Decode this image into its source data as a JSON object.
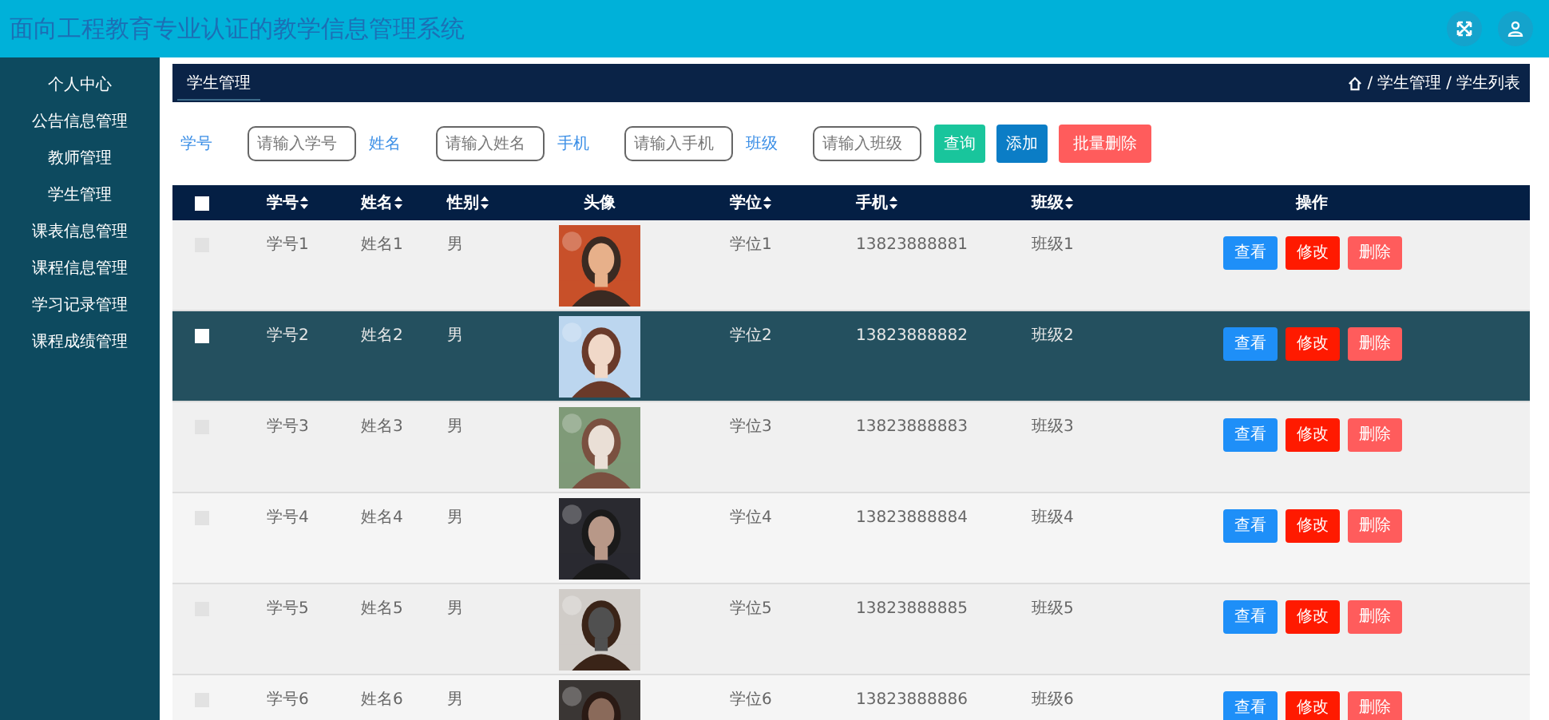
{
  "header": {
    "title": "面向工程教育专业认证的教学信息管理系统"
  },
  "sidebar": {
    "items": [
      {
        "label": "个人中心"
      },
      {
        "label": "公告信息管理"
      },
      {
        "label": "教师管理"
      },
      {
        "label": "学生管理"
      },
      {
        "label": "课表信息管理"
      },
      {
        "label": "课程信息管理"
      },
      {
        "label": "学习记录管理"
      },
      {
        "label": "课程成绩管理"
      }
    ]
  },
  "tab": {
    "label": "学生管理"
  },
  "breadcrumb": [
    {
      "separator": "/",
      "label": "学生管理"
    },
    {
      "separator": "/",
      "label": "学生列表"
    }
  ],
  "search": {
    "fields": [
      {
        "label": "学号",
        "placeholder": "请输入学号"
      },
      {
        "label": "姓名",
        "placeholder": "请输入姓名"
      },
      {
        "label": "手机",
        "placeholder": "请输入手机"
      },
      {
        "label": "班级",
        "placeholder": "请输入班级"
      }
    ],
    "buttons": [
      {
        "label": "查询",
        "kind": "search"
      },
      {
        "label": "添加",
        "kind": "add"
      },
      {
        "label": "批量删除",
        "kind": "delete"
      }
    ]
  },
  "table": {
    "select_all_checked": false,
    "columns": [
      {
        "label": "学号",
        "sortable": true
      },
      {
        "label": "姓名",
        "sortable": true
      },
      {
        "label": "性别",
        "sortable": true
      },
      {
        "label": "头像",
        "sortable": false
      },
      {
        "label": "学位",
        "sortable": true
      },
      {
        "label": "手机",
        "sortable": true
      },
      {
        "label": "班级",
        "sortable": true
      },
      {
        "label": "操作",
        "sortable": false
      }
    ],
    "rows": [
      {
        "selected": false,
        "cells": [
          "学号1",
          "姓名1",
          "男",
          {
            "kind": "picture"
          },
          "学位1",
          "13823888881",
          "班级1"
        ],
        "actions": [
          "查看",
          "修改",
          "删除"
        ]
      },
      {
        "selected": true,
        "cells": [
          "学号2",
          "姓名2",
          "男",
          {
            "kind": "picture"
          },
          "学位2",
          "13823888882",
          "班级2"
        ],
        "actions": [
          "查看",
          "修改",
          "删除"
        ]
      },
      {
        "selected": false,
        "cells": [
          "学号3",
          "姓名3",
          "男",
          {
            "kind": "picture"
          },
          "学位3",
          "13823888883",
          "班级3"
        ],
        "actions": [
          "查看",
          "修改",
          "删除"
        ]
      },
      {
        "selected": false,
        "cells": [
          "学号4",
          "姓名4",
          "男",
          {
            "kind": "picture"
          },
          "学位4",
          "13823888884",
          "班级4"
        ],
        "actions": [
          "查看",
          "修改",
          "删除"
        ]
      },
      {
        "selected": false,
        "cells": [
          "学号5",
          "姓名5",
          "男",
          {
            "kind": "picture"
          },
          "学位5",
          "13823888885",
          "班级5"
        ],
        "actions": [
          "查看",
          "修改",
          "删除"
        ]
      },
      {
        "selected": false,
        "cells": [
          "学号6",
          "姓名6",
          "男",
          {
            "kind": "picture"
          },
          "学位6",
          "13823888886",
          "班级6"
        ],
        "actions": [
          "查看",
          "修改",
          "删除"
        ]
      }
    ]
  }
}
